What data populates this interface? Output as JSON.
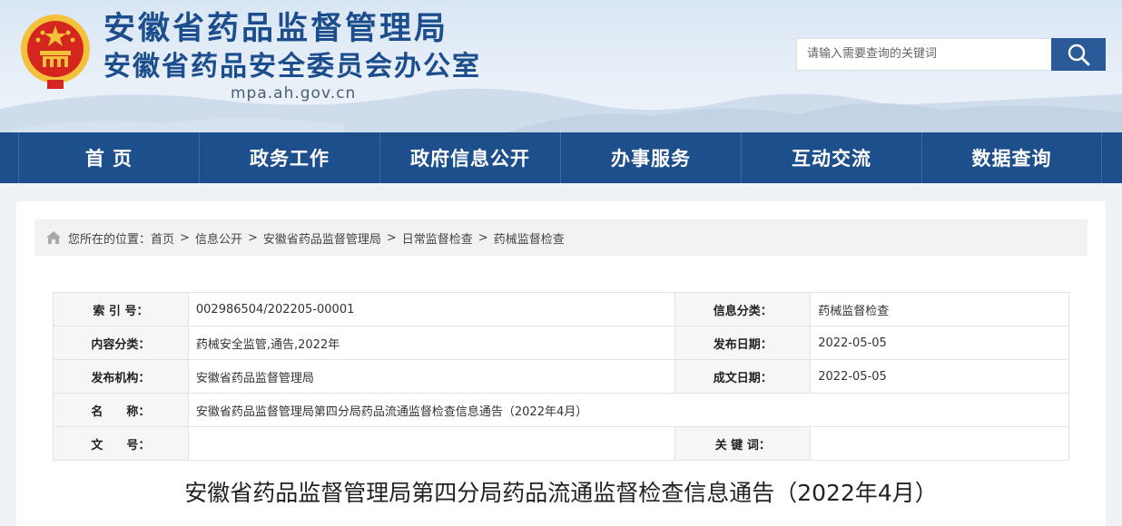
{
  "header": {
    "title": "安徽省药品监督管理局",
    "subtitle": "安徽省药品安全委员会办公室",
    "domain": "mpa.ah.gov.cn",
    "search_placeholder": "请输入需要查询的关键词"
  },
  "nav": {
    "items": [
      "首 页",
      "政务工作",
      "政府信息公开",
      "办事服务",
      "互动交流",
      "数据查询"
    ]
  },
  "breadcrumb": {
    "prefix": "您所在的位置：",
    "items": [
      "首页",
      "信息公开",
      "安徽省药品监督管理局",
      "日常监督检查",
      "药械监督检查"
    ],
    "sep": ">"
  },
  "meta": {
    "index_label": "索 引 号：",
    "index_value": "002986504/202205-00001",
    "category_label": "信息分类：",
    "category_value": "药械监督检查",
    "content_label": "内容分类：",
    "content_value": "药械安全监管,通告,2022年",
    "pubdate_label": "发布日期：",
    "pubdate_value": "2022-05-05",
    "org_label": "发布机构：",
    "org_value": "安徽省药品监督管理局",
    "docdate_label": "成文日期：",
    "docdate_value": "2022-05-05",
    "name_label": "名　　称：",
    "name_value": "安徽省药品监督管理局第四分局药品流通监督检查信息通告（2022年4月）",
    "docno_label": "文　　号：",
    "docno_value": "",
    "keywords_label": "关 键 词：",
    "keywords_value": ""
  },
  "article": {
    "title": "安徽省药品监督管理局第四分局药品流通监督检查信息通告（2022年4月）"
  },
  "colors": {
    "nav_bg": "#1e4f8d",
    "title_blue": "#1c4d8c",
    "search_btn": "#2a5a97",
    "emblem_red": "#d4261e",
    "emblem_gold": "#f3c13a"
  },
  "icons": {
    "emblem": "national-emblem-icon",
    "search": "search-icon",
    "home": "home-icon"
  }
}
